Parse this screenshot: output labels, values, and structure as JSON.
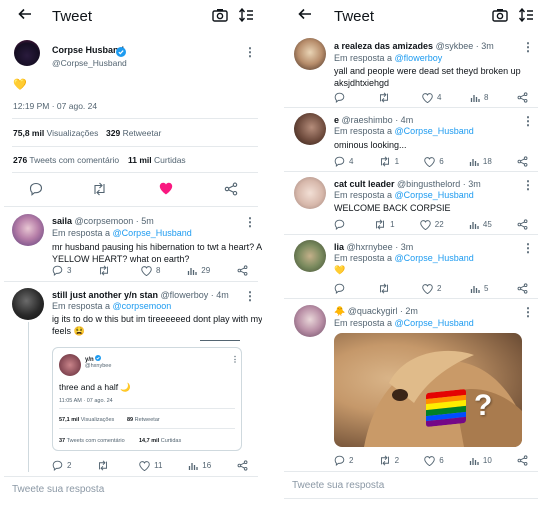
{
  "left": {
    "header": {
      "title": "Tweet"
    },
    "main": {
      "author_name": "Corpse Husband",
      "author_handle": "@Corpse_Husband",
      "text": "💛",
      "timestamp": "12:19 PM · 07 ago. 24",
      "views_count": "75,8 mil",
      "views_label": "Visualizações",
      "retweets_count": "329",
      "retweets_label": "Retweetar",
      "quotes_count": "276",
      "quotes_label": "Tweets com comentário",
      "likes_count": "11 mil",
      "likes_label": "Curtidas"
    },
    "replies": [
      {
        "name": "saila",
        "handle": "@corpsemoon · 5m",
        "reply_prefix": "Em resposta a",
        "reply_to": "@Corpse_Husband",
        "text_line1": "mr husband pausing his hibernation to twt a heart? A",
        "text_line2": "YELLOW HEART?  what on earth?",
        "stats": {
          "replies": "3",
          "retweets": "",
          "likes": "8",
          "views": "29"
        }
      },
      {
        "name": "still just another y/n stan",
        "handle": "@flowerboy · 4m",
        "reply_prefix": "Em resposta a",
        "reply_to": "@corpsemoon",
        "text_line1": "ig its to do w this but im tireeeeeed dont play with my",
        "text_line2": "feels 😫",
        "stats": {
          "replies": "2",
          "retweets": "",
          "likes": "11",
          "views": "16"
        },
        "quote": {
          "name": "y/n",
          "handle": "@hxnybee",
          "text": "three and a half 🌙",
          "timestamp": "11:05 AM · 07 ago. 24",
          "views_count": "57,1 mil",
          "views_label": "Visualizações",
          "retweets_count": "89",
          "retweets_label": "Retweetar",
          "quotes_count": "37",
          "quotes_label": "Tweets com comentário",
          "likes_count": "14,7 mil",
          "likes_label": "Curtidas"
        }
      }
    ],
    "reply_input": {
      "placeholder": "Tweete sua resposta"
    }
  },
  "right": {
    "header": {
      "title": "Tweet"
    },
    "replies": [
      {
        "name": "a realeza das amizades",
        "handle": "@sykbee · 3m",
        "reply_prefix": "Em resposta a",
        "reply_to": "@flowerboy",
        "text_line1": "yall and people were dead set theyd broken up",
        "text_line2": "aksjdhtxiehgd",
        "stats": {
          "replies": "",
          "retweets": "",
          "likes": "4",
          "views": "8"
        }
      },
      {
        "name": "e",
        "handle": "@raeshimbo · 4m",
        "reply_prefix": "Em resposta a",
        "reply_to": "@Corpse_Husband",
        "text_line1": "ominous looking...",
        "stats": {
          "replies": "4",
          "retweets": "1",
          "likes": "6",
          "views": "18"
        }
      },
      {
        "name": "cat cult leader",
        "handle": "@bingusthelord · 3m",
        "reply_prefix": "Em resposta a",
        "reply_to": "@Corpse_Husband",
        "text_line1": "WELCOME BACK CORPSIE",
        "stats": {
          "replies": "",
          "retweets": "1",
          "likes": "22",
          "views": "45"
        }
      },
      {
        "name": "lia",
        "handle": "@hxrnybee · 3m",
        "reply_prefix": "Em resposta a",
        "reply_to": "@Corpse_Husband",
        "text_line1": "💛",
        "stats": {
          "replies": "",
          "retweets": "",
          "likes": "2",
          "views": "5"
        }
      },
      {
        "name": "🐥",
        "handle": "@quackygirl · 2m",
        "reply_prefix": "Em resposta a",
        "reply_to": "@Corpse_Husband",
        "image_overlay": "?",
        "stats": {
          "replies": "2",
          "retweets": "2",
          "likes": "6",
          "views": "10"
        }
      }
    ],
    "reply_input": {
      "placeholder": "Tweete sua resposta"
    }
  },
  "colors": {
    "accent": "#1d9bf0",
    "like": "#f91880",
    "verified": "#1d9bf0",
    "heart_yellow": "#f5c518"
  }
}
